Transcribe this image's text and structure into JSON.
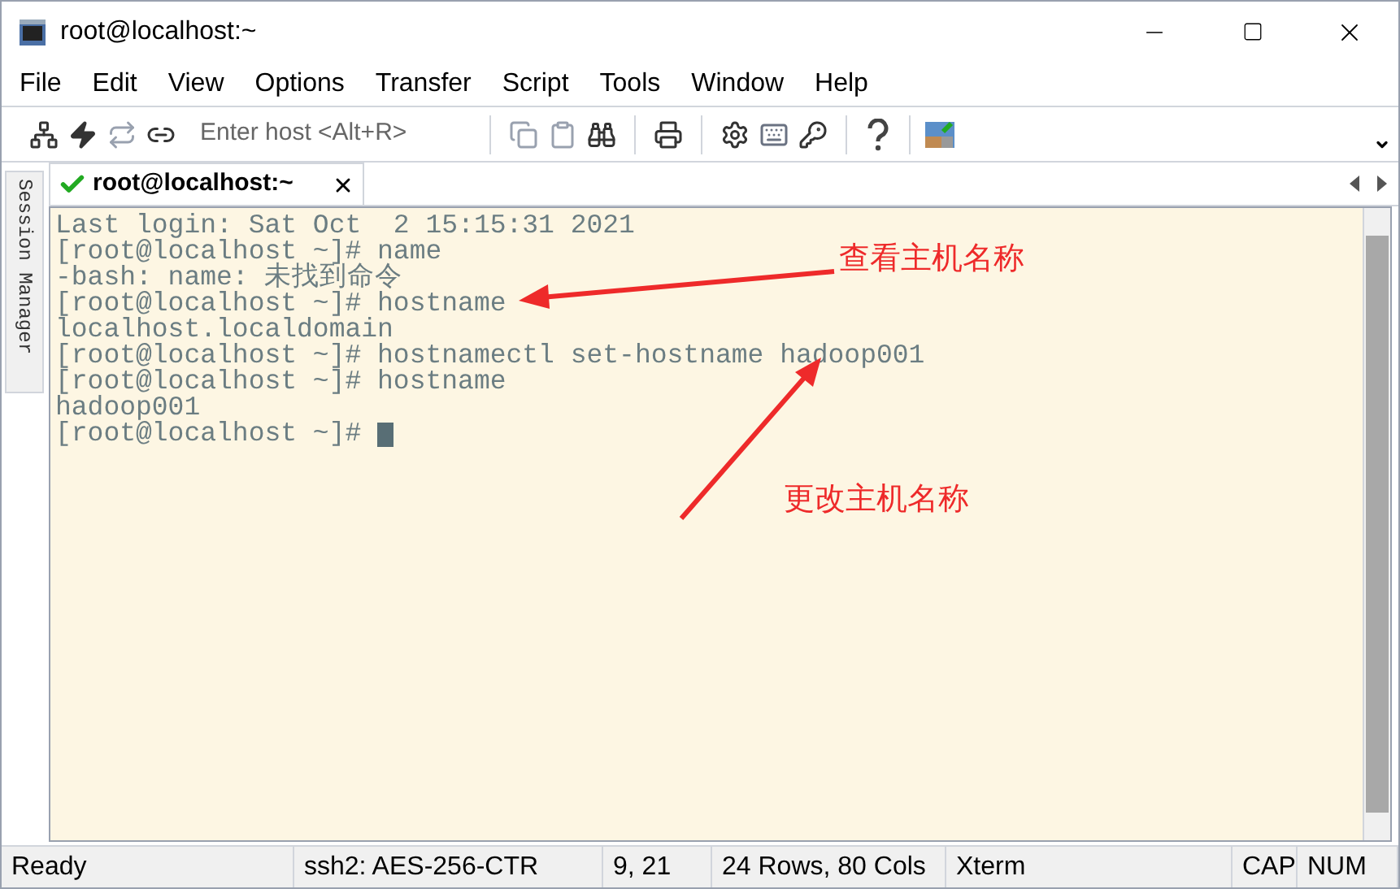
{
  "window": {
    "title": "root@localhost:~"
  },
  "menu": [
    "File",
    "Edit",
    "View",
    "Options",
    "Transfer",
    "Script",
    "Tools",
    "Window",
    "Help"
  ],
  "toolbar": {
    "host_placeholder": "Enter host <Alt+R>"
  },
  "tabs": [
    {
      "label": "root@localhost:~",
      "selected": true,
      "connected": true
    }
  ],
  "sidebar": {
    "label": "Session Manager"
  },
  "terminal": {
    "lines": [
      "Last login: Sat Oct  2 15:15:31 2021",
      "[root@localhost ~]# name",
      "-bash: name: 未找到命令",
      "[root@localhost ~]# hostname",
      "localhost.localdomain",
      "[root@localhost ~]# hostnamectl set-hostname hadoop001",
      "[root@localhost ~]# hostname",
      "hadoop001",
      "[root@localhost ~]# "
    ]
  },
  "annotations": [
    {
      "text": "查看主机名称"
    },
    {
      "text": "更改主机名称"
    }
  ],
  "status_bar": [
    "Ready",
    "ssh2: AES-256-CTR",
    "9,  21",
    "24 Rows, 80 Cols",
    "Xterm",
    "CAP",
    "NUM"
  ]
}
